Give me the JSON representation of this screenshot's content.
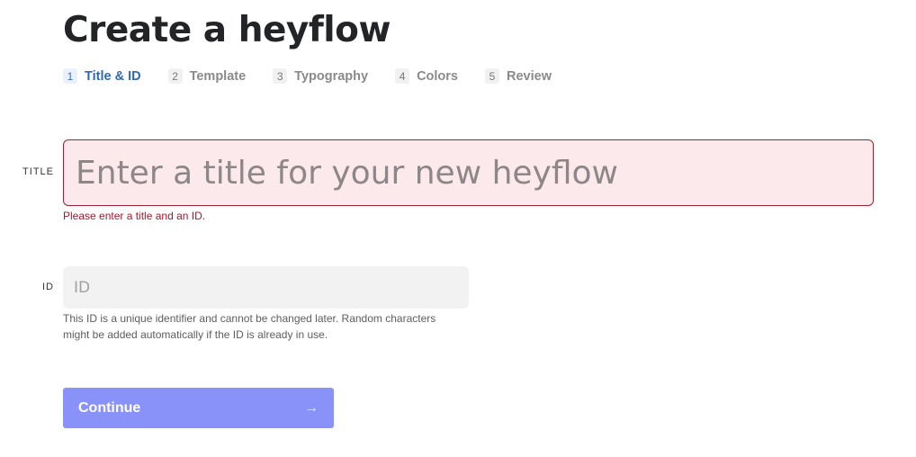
{
  "page": {
    "title": "Create a heyflow"
  },
  "steps": [
    {
      "number": "1",
      "label": "Title & ID",
      "active": true
    },
    {
      "number": "2",
      "label": "Template",
      "active": false
    },
    {
      "number": "3",
      "label": "Typography",
      "active": false
    },
    {
      "number": "4",
      "label": "Colors",
      "active": false
    },
    {
      "number": "5",
      "label": "Review",
      "active": false
    }
  ],
  "form": {
    "title_label": "TITLE",
    "title_value": "",
    "title_placeholder": "Enter a title for your new heyflow",
    "error_message": "Please enter a title and an ID.",
    "id_label": "ID",
    "id_value": "",
    "id_placeholder": "ID",
    "id_help": "This ID is a unique identifier and cannot be changed later. Random characters might be added automatically if the ID is already in use.",
    "continue_label": "Continue",
    "continue_icon": "→"
  },
  "colors": {
    "accent": "#2f68b3",
    "error": "#a4182f",
    "error_bg": "#fbe9ec",
    "button": "#8892f8"
  }
}
